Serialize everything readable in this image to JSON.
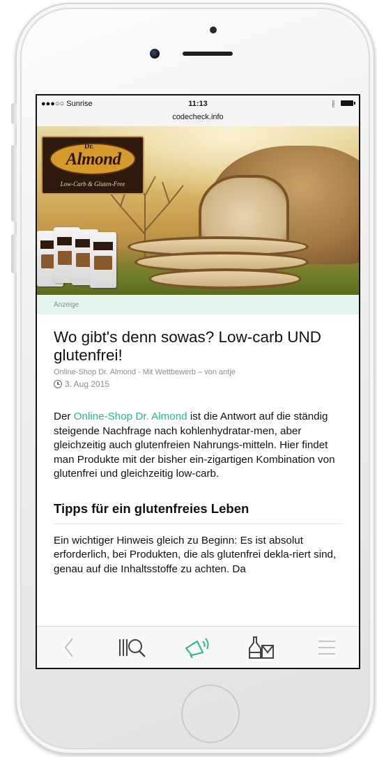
{
  "status": {
    "carrier": "●●●○○ Sunrise",
    "time": "11:13",
    "url": "codecheck.info",
    "bluetooth": "∦"
  },
  "hero": {
    "logo_dr": "Dr.",
    "logo_name": "Almond",
    "logo_tagline": "Low-Carb & Gluten-Free"
  },
  "ad_label": "Anzeige",
  "article": {
    "title": "Wo gibt's denn sowas? Low-carb UND glutenfrei!",
    "meta": "Online-Shop Dr. Almond - Mit Wettbewerb – von antje",
    "date": "3. Aug 2015",
    "para1_prefix": "Der ",
    "para1_link": "Online-Shop Dr. Almond",
    "para1_rest": " ist die Antwort auf die ständig steigende Nachfrage nach kohlenhydratar-men, aber gleichzeitig auch glutenfreien Nahrungs-mitteln. Hier findet man Produkte mit der bisher ein-zigartigen Kombination von glutenfrei und gleichzeitig low-carb.",
    "subhead": "Tipps für ein glutenfreies Leben",
    "para2": "Ein wichtiger Hinweis gleich zu Beginn: Es ist absolut erforderlich, bei Produkten, die als glutenfrei dekla-riert sind, genau auf die Inhaltsstoffe zu achten. Da"
  },
  "tabbar": {
    "items": [
      {
        "icon": "back-chevron-icon",
        "active": false
      },
      {
        "icon": "barcode-search-icon",
        "active": false
      },
      {
        "icon": "megaphone-icon",
        "active": true
      },
      {
        "icon": "products-icon",
        "active": false
      },
      {
        "icon": "menu-icon",
        "active": false
      }
    ],
    "active_color": "#2bb68a",
    "inactive_color": "#9a9a9a"
  },
  "colors": {
    "accent": "#2bb68a",
    "ad_bg": "#e6f4ee"
  }
}
